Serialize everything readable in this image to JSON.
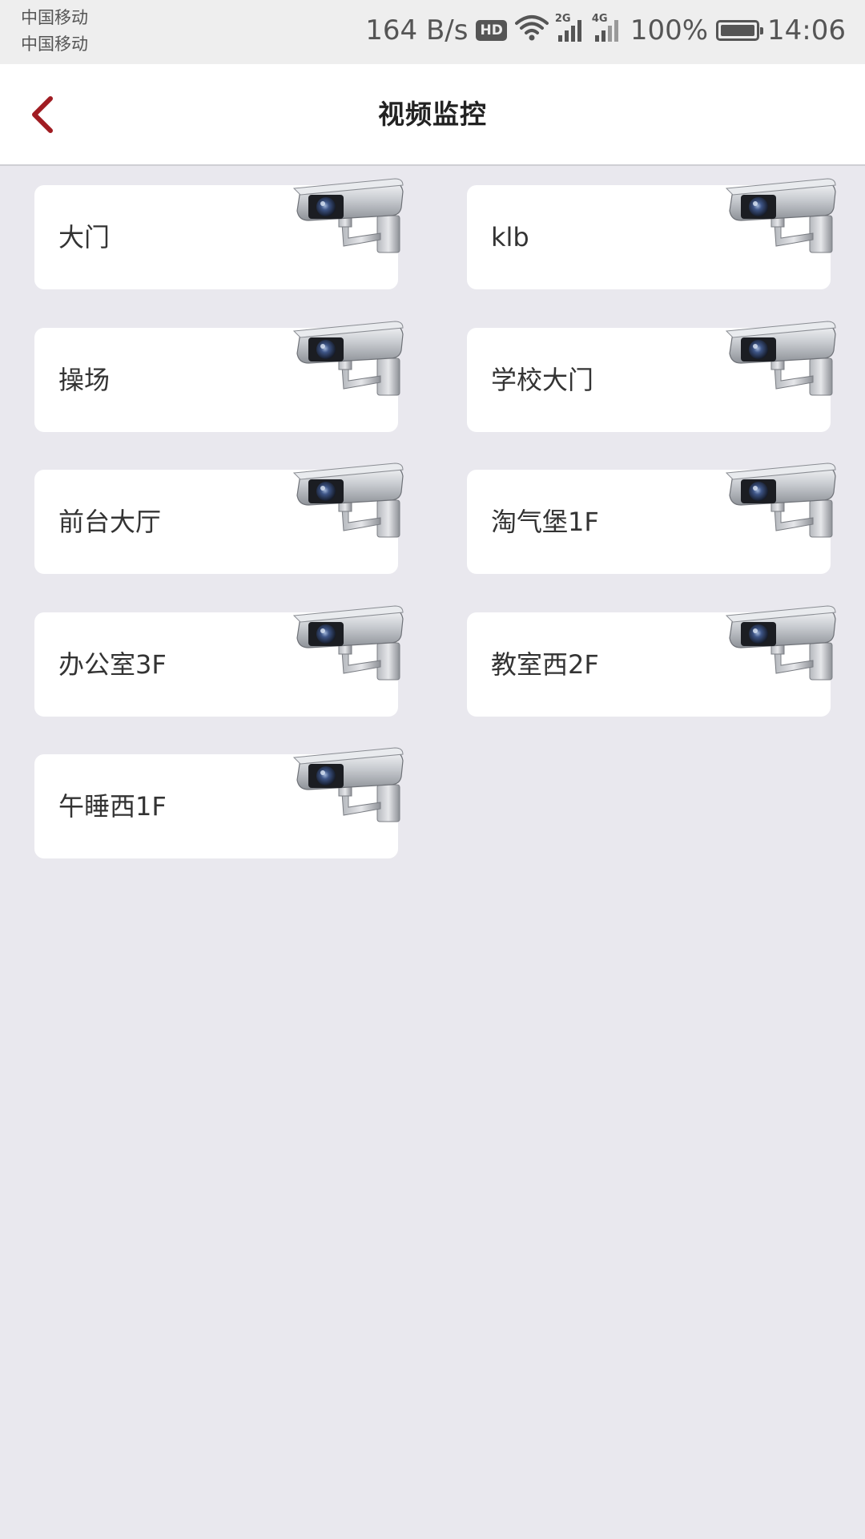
{
  "status_bar": {
    "carrier_1": "中国移动",
    "carrier_2": "中国移动",
    "net_speed": "164 B/s",
    "hd_badge": "HD",
    "sim1_tag": "2G",
    "sim2_tag": "4G",
    "battery_pct": "100%",
    "time": "14:06",
    "icons": [
      "wifi-icon",
      "signal-icon",
      "battery-icon"
    ]
  },
  "header": {
    "title": "视频监控",
    "back_icon": "chevron-left-icon"
  },
  "colors": {
    "accent": "#a01c22",
    "background": "#e9e8ee",
    "card": "#ffffff"
  },
  "cameras": [
    {
      "label": "大门"
    },
    {
      "label": "klb"
    },
    {
      "label": "操场"
    },
    {
      "label": "学校大门"
    },
    {
      "label": "前台大厅"
    },
    {
      "label": "淘气堡1F"
    },
    {
      "label": "办公室3F"
    },
    {
      "label": "教室西2F"
    },
    {
      "label": "午睡西1F"
    }
  ]
}
